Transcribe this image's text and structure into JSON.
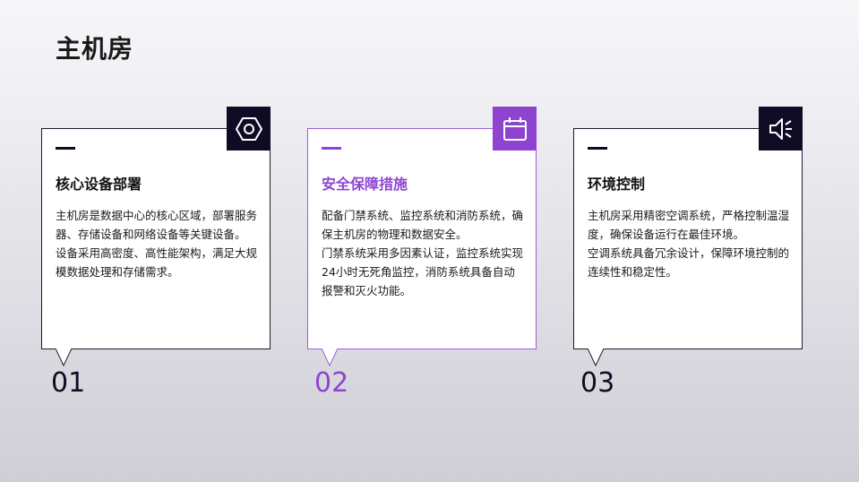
{
  "page": {
    "title": "主机房"
  },
  "cards": [
    {
      "number": "01",
      "heading": "核心设备部署",
      "icon": "hexagon-settings-icon",
      "paragraphs": [
        "主机房是数据中心的核心区域，部署服务器、存储设备和网络设备等关键设备。",
        "设备采用高密度、高性能架构，满足大规模数据处理和存储需求。"
      ]
    },
    {
      "number": "02",
      "heading": "安全保障措施",
      "icon": "calendar-icon",
      "paragraphs": [
        "配备门禁系统、监控系统和消防系统，确保主机房的物理和数据安全。",
        "门禁系统采用多因素认证，监控系统实现24小时无死角监控，消防系统具备自动报警和灭火功能。"
      ]
    },
    {
      "number": "03",
      "heading": "环境控制",
      "icon": "speaker-icon",
      "paragraphs": [
        "主机房采用精密空调系统，严格控制温湿度，确保设备运行在最佳环境。",
        "空调系统具备冗余设计，保障环境控制的连续性和稳定性。"
      ]
    }
  ],
  "colors": {
    "dark": "#0e0c24",
    "accent": "#8e44d1"
  }
}
